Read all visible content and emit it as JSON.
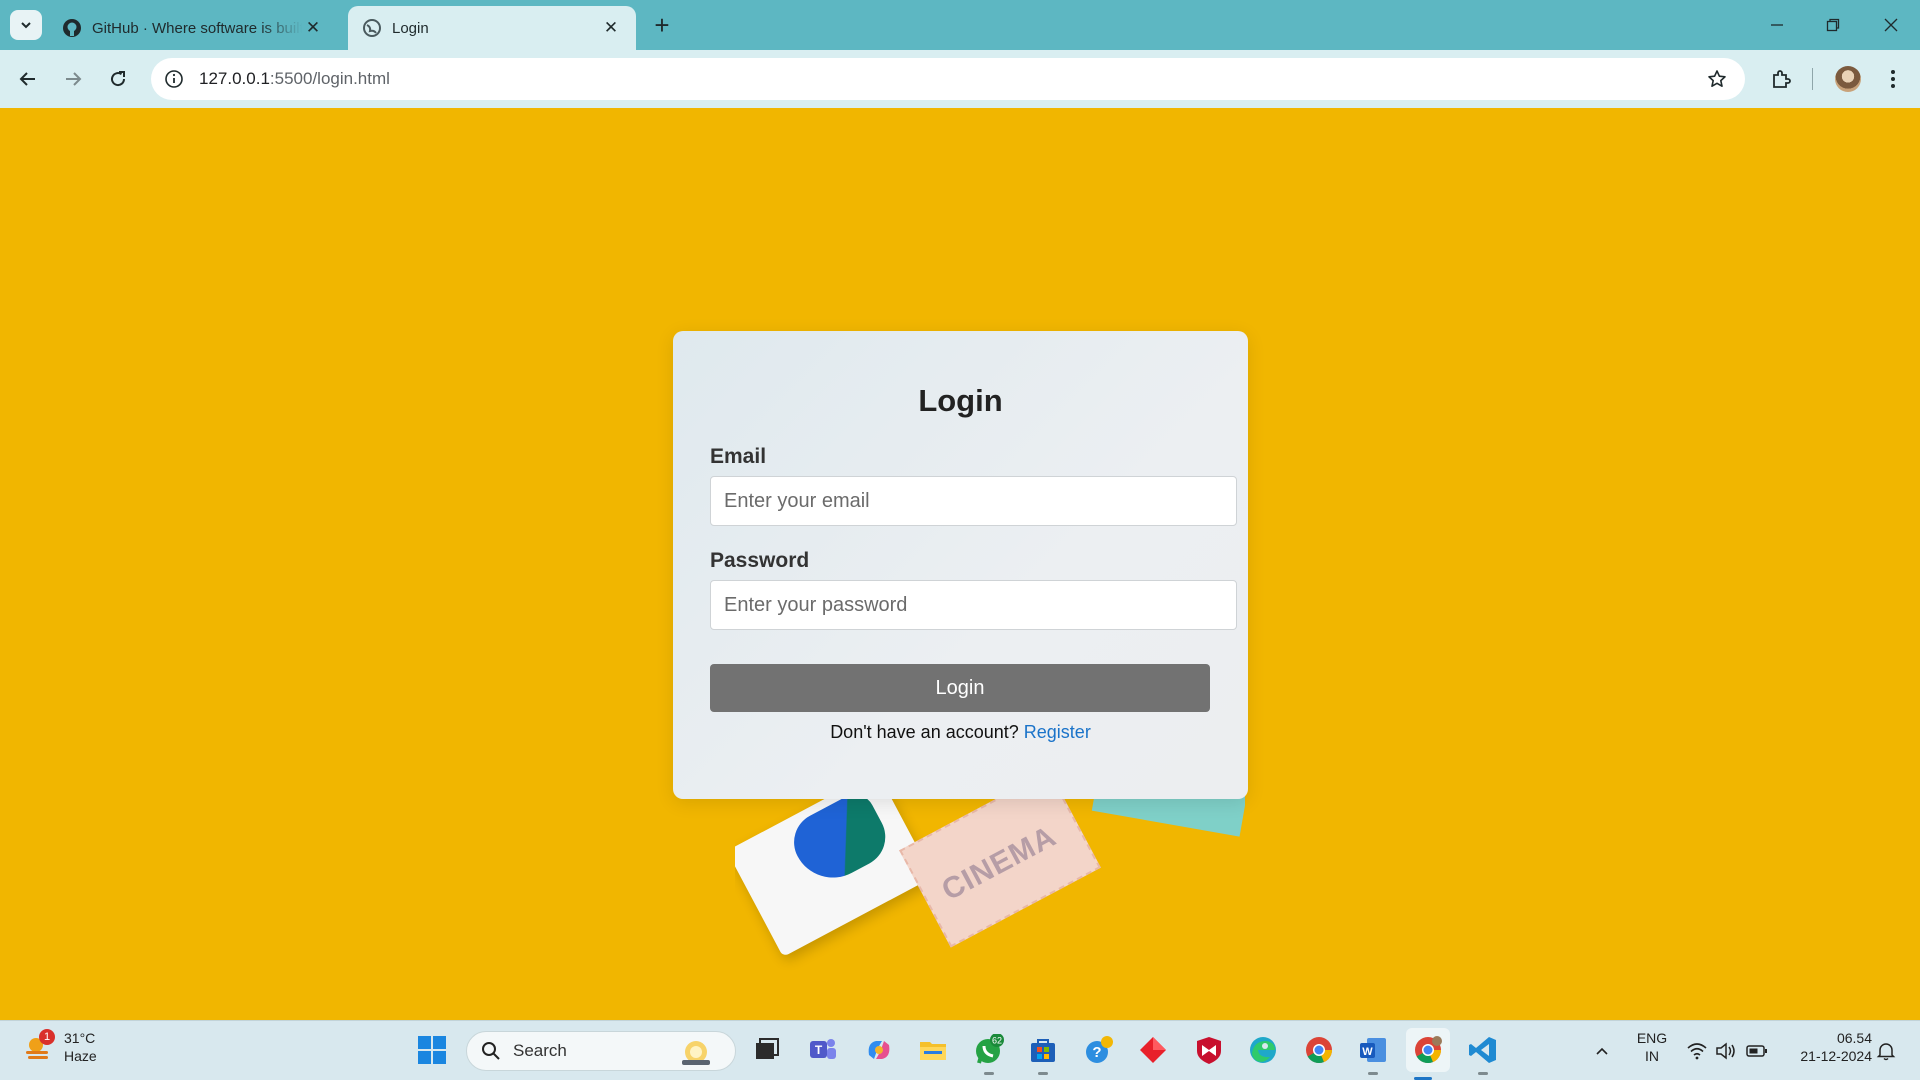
{
  "browser": {
    "tabs": [
      {
        "title": "GitHub · Where software is built",
        "favicon": "github-icon",
        "active": false
      },
      {
        "title": "Login",
        "favicon": "globe-icon",
        "active": true
      }
    ],
    "new_tab": "+",
    "url_host": "127.0.0.1",
    "url_path": ":5500/login.html"
  },
  "login": {
    "title": "Login",
    "email_label": "Email",
    "email_placeholder": "Enter your email",
    "password_label": "Password",
    "password_placeholder": "Enter your password",
    "button_label": "Login",
    "footer_text": "Don't have an account?",
    "register_link": "Register"
  },
  "photo": {
    "ticket_text": "CINEMA"
  },
  "taskbar": {
    "weather_temp": "31°C",
    "weather_desc": "Haze",
    "weather_badge": "1",
    "search_label": "Search",
    "whatsapp_badge": "62",
    "language_top": "ENG",
    "language_bottom": "IN",
    "time": "06.54",
    "date": "21-12-2024"
  },
  "colors": {
    "page_bg": "#f1b600",
    "button_bg": "#727272",
    "link": "#1a73c9",
    "tabbar": "#5db7c2"
  }
}
